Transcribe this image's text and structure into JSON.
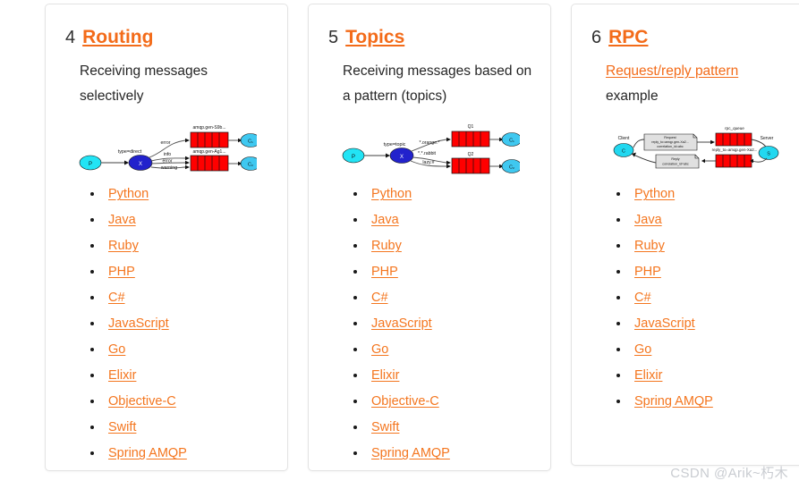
{
  "watermark": "CSDN @Arik~朽木",
  "colors": {
    "link_orange": "#f4761f",
    "title_orange": "#f36b19",
    "queue_red": "#ff0000",
    "node_blue": "#2222cc",
    "node_cyan": "#22d8f0",
    "consumer_blue": "#3fc8f0",
    "card_border": "#e3e3e3",
    "text_dark": "#262626",
    "watermark_grey": "#c9ccd1"
  },
  "cards": [
    {
      "number": "4",
      "title": "Routing",
      "subtitle": "Receiving messages selectively",
      "subtitle_is_link": false,
      "subtitle_extra": "",
      "diagram": {
        "type": "direct-exchange",
        "producer": "P",
        "exchange": "X",
        "exchange_label": "type=direct",
        "bindings": [
          "error",
          "info",
          "error",
          "warning"
        ],
        "queues": [
          {
            "label": "amqp.gen-S9b...",
            "consumer": "C₁"
          },
          {
            "label": "amqp.gen-Ag1...",
            "consumer": "C₂"
          }
        ]
      },
      "languages": [
        "Python",
        "Java",
        "Ruby",
        "PHP",
        "C#",
        "JavaScript",
        "Go",
        "Elixir",
        "Objective-C",
        "Swift",
        "Spring AMQP"
      ]
    },
    {
      "number": "5",
      "title": "Topics",
      "subtitle": "Receiving messages based on a pattern (topics)",
      "subtitle_is_link": false,
      "subtitle_extra": "",
      "diagram": {
        "type": "topic-exchange",
        "producer": "P",
        "exchange": "X",
        "exchange_label": "type=topic",
        "bindings": [
          "*.orange.*",
          "*.*.rabbit",
          "lazy.#"
        ],
        "queues": [
          {
            "label": "Q1",
            "consumer": "C₁"
          },
          {
            "label": "Q2",
            "consumer": "C₂"
          }
        ]
      },
      "languages": [
        "Python",
        "Java",
        "Ruby",
        "PHP",
        "C#",
        "JavaScript",
        "Go",
        "Elixir",
        "Objective-C",
        "Swift",
        "Spring AMQP"
      ]
    },
    {
      "number": "6",
      "title": "RPC",
      "subtitle": "Request/reply pattern",
      "subtitle_is_link": true,
      "subtitle_extra": "example",
      "diagram": {
        "type": "rpc",
        "client_label": "Client",
        "client": "C",
        "server_label": "Server",
        "server": "S",
        "request_box": "Request\nreply_to=amqp.gen-Xa2...\ncorrelation_id=abc",
        "reply_box": "Reply\ncorrelation_id=abc",
        "queues": [
          {
            "label": "rpc_queue"
          },
          {
            "label": "reply_to=amqp.gen-Xa2..."
          }
        ]
      },
      "languages": [
        "Python",
        "Java",
        "Ruby",
        "PHP",
        "C#",
        "JavaScript",
        "Go",
        "Elixir",
        "Spring AMQP"
      ]
    }
  ]
}
